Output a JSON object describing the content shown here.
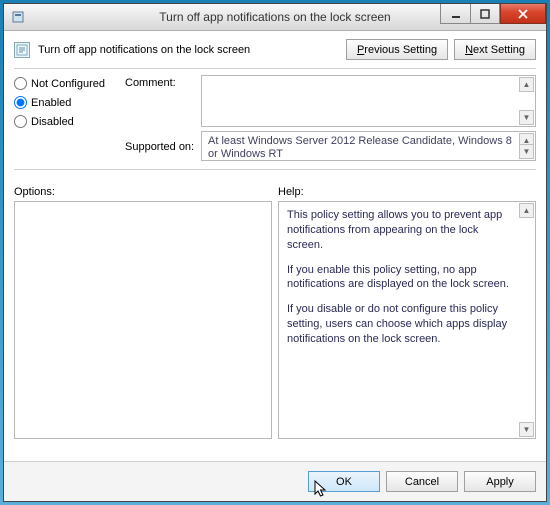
{
  "window": {
    "title": "Turn off app notifications on the lock screen"
  },
  "header": {
    "policy_title": "Turn off app notifications on the lock screen",
    "prev_button": "Previous Setting",
    "next_button_pre": "N",
    "next_button_rest": "ext Setting"
  },
  "radios": {
    "not_configured": "Not Configured",
    "enabled": "Enabled",
    "disabled": "Disabled",
    "selected": "enabled"
  },
  "labels": {
    "comment": "Comment:",
    "supported_on": "Supported on:",
    "options": "Options:",
    "help": "Help:"
  },
  "fields": {
    "comment_value": "",
    "supported_text": "At least Windows Server 2012 Release Candidate, Windows 8 or Windows RT"
  },
  "help": {
    "p1": "This policy setting allows you to prevent app notifications from appearing on the lock screen.",
    "p2": "If you enable this policy setting, no app notifications are displayed on the lock screen.",
    "p3": "If you disable or do not configure this policy setting, users can choose which apps display notifications on the lock screen."
  },
  "buttons": {
    "ok": "OK",
    "cancel": "Cancel",
    "apply": "Apply"
  }
}
